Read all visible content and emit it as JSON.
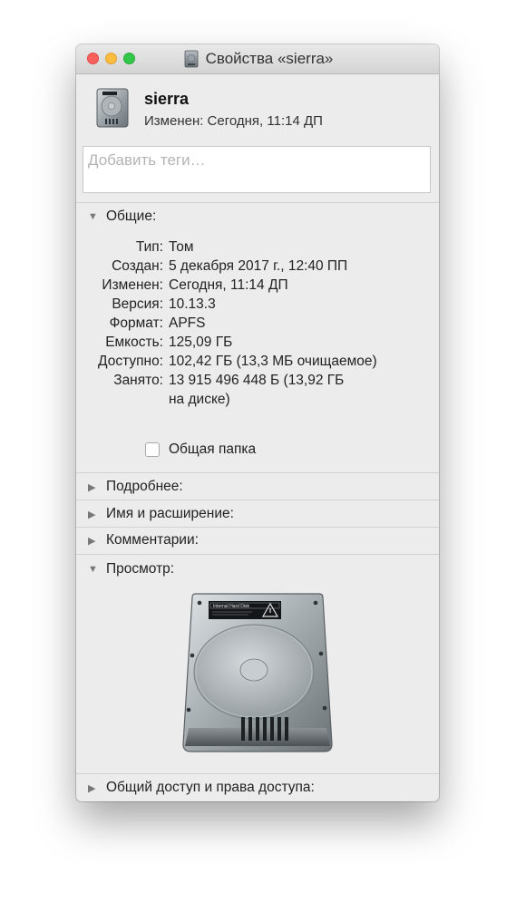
{
  "window": {
    "title": "Свойства «sierra»"
  },
  "header": {
    "name": "sierra",
    "modified": "Изменен: Сегодня, 11:14 ДП"
  },
  "tags": {
    "placeholder": "Добавить теги…"
  },
  "general": {
    "label": "Общие:",
    "rows": [
      {
        "key": "Тип:",
        "value": "Том"
      },
      {
        "key": "Создан:",
        "value": "5 декабря 2017 г., 12:40 ПП"
      },
      {
        "key": "Изменен:",
        "value": "Сегодня, 11:14 ДП"
      },
      {
        "key": "Версия:",
        "value": "10.13.3"
      },
      {
        "key": "Формат:",
        "value": "APFS"
      },
      {
        "key": "Емкость:",
        "value": "125,09 ГБ"
      },
      {
        "key": "Доступно:",
        "value": "102,42 ГБ (13,3 МБ очищаемое)"
      },
      {
        "key": "Занято:",
        "value": "13 915 496 448 Б (13,92 ГБ",
        "value2": "на диске)"
      }
    ],
    "shared_folder_label": "Общая папка"
  },
  "sections": {
    "more_info": "Подробнее:",
    "name_ext": "Имя и расширение:",
    "comments": "Комментарии:",
    "preview": "Просмотр:",
    "sharing": "Общий доступ и права доступа:"
  },
  "preview": {
    "disk_label_text": "Internal Hard Disk"
  },
  "icons": {
    "close": "close-button-red",
    "minimize": "minimize-button-yellow",
    "zoom": "zoom-button-green",
    "disk": "hard-disk-icon",
    "expanded": "disclosure-down",
    "collapsed": "disclosure-right"
  },
  "colors": {
    "close": "#fc605c",
    "minimize": "#fdbc40",
    "zoom": "#34c84a",
    "window_bg": "#ececec"
  }
}
